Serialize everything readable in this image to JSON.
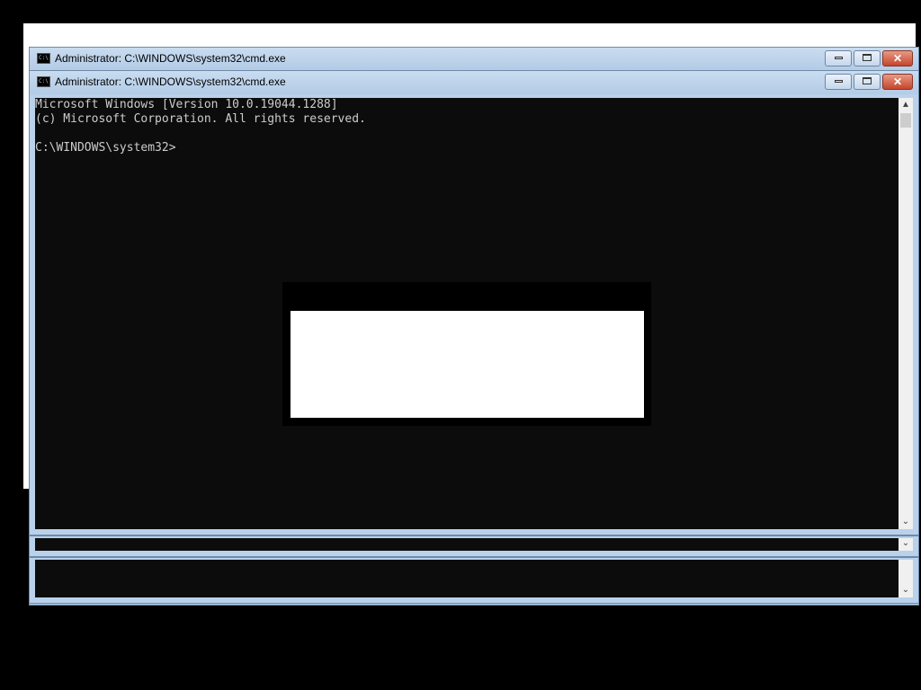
{
  "windows": {
    "back": {
      "title": "Administrator: C:\\WINDOWS\\system32\\cmd.exe"
    },
    "front": {
      "title": "Administrator: C:\\WINDOWS\\system32\\cmd.exe",
      "console_lines": [
        "Microsoft Windows [Version 10.0.19044.1288]",
        "(c) Microsoft Corporation. All rights reserved.",
        "",
        "C:\\WINDOWS\\system32>"
      ]
    }
  },
  "icons": {
    "app": "cmd-icon",
    "minimize": "minimize-icon",
    "maximize": "maximize-icon",
    "close": "close-icon",
    "scroll_up": "chevron-up-icon",
    "scroll_down": "chevron-down-icon"
  },
  "colors": {
    "console_bg": "#0c0c0c",
    "console_fg": "#cccccc",
    "frame": "#b9d1ea",
    "close": "#c6452c"
  }
}
